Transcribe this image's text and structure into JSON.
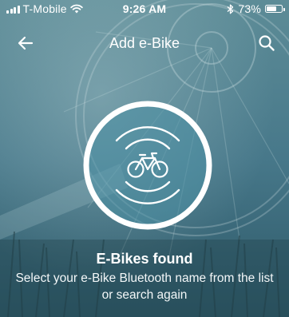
{
  "status_bar": {
    "carrier": "T-Mobile",
    "time": "9:26 AM",
    "battery": "73%",
    "battery_level": 0.73,
    "icons": [
      "signal-icon",
      "wifi-icon",
      "bluetooth-icon",
      "battery-icon"
    ]
  },
  "nav": {
    "title": "Add e-Bike",
    "back_icon": "arrow-left-icon",
    "search_icon": "search-icon"
  },
  "scan": {
    "icon": "bicycle-icon",
    "heading": "E-Bikes found",
    "message": "Select your e-Bike Bluetooth name from the list or search again"
  },
  "colors": {
    "background": "#3d6d7a",
    "ring": "#ffffff",
    "circle_fill": "#4a90a4"
  }
}
